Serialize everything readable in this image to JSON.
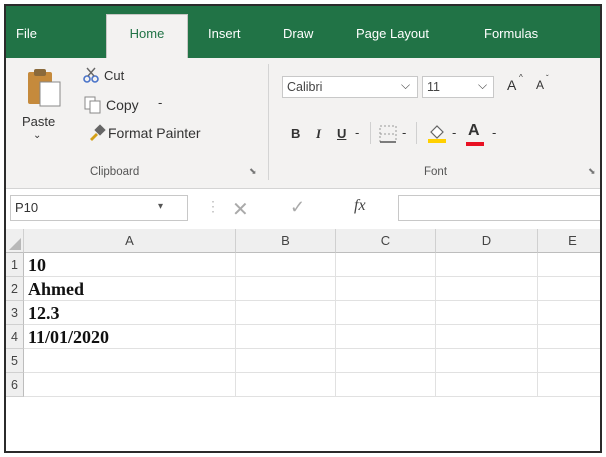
{
  "tabs": [
    "File",
    "Home",
    "Insert",
    "Draw",
    "Page Layout",
    "Formulas"
  ],
  "active_tab": "Home",
  "clipboard": {
    "paste_label": "Paste",
    "cut_label": "Cut",
    "copy_label": "Copy",
    "format_painter_label": "Format Painter",
    "group_label": "Clipboard"
  },
  "font": {
    "family": "Calibri",
    "size": "11",
    "grow_label": "A",
    "shrink_label": "A",
    "bold_label": "B",
    "italic_label": "I",
    "underline_label": "U",
    "font_color_label": "A",
    "group_label": "Font"
  },
  "formula_bar": {
    "name_box": "P10",
    "fx_label": "fx",
    "formula_value": ""
  },
  "sheet": {
    "columns": [
      "A",
      "B",
      "C",
      "D",
      "E"
    ],
    "rows": [
      "1",
      "2",
      "3",
      "4",
      "5",
      "6"
    ],
    "cells_a": [
      "10",
      "Ahmed",
      "12.3",
      "11/01/2020",
      "",
      ""
    ]
  },
  "colors": {
    "accent": "#217346",
    "font_color_bar": "#e81123",
    "fill_color_bar": "#ffd000"
  }
}
